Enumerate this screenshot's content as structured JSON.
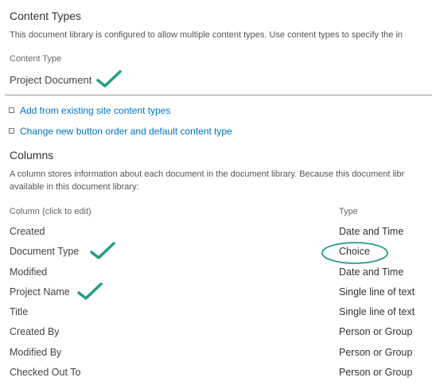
{
  "content_types": {
    "title": "Content Types",
    "description": "This document library is configured to allow multiple content types. Use content types to specify the in",
    "column_header": "Content Type",
    "items": [
      "Project Document"
    ]
  },
  "links": [
    {
      "label": "Add from existing site content types"
    },
    {
      "label": "Change new button order and default content type"
    }
  ],
  "columns": {
    "title": "Columns",
    "description_line1": "A column stores information about each document in the document library. Because this document libr",
    "description_line2": "available in this document library:",
    "header_column": "Column (click to edit)",
    "header_type": "Type",
    "rows": [
      {
        "name": "Created",
        "type": "Date and Time"
      },
      {
        "name": "Document Type",
        "type": "Choice"
      },
      {
        "name": "Modified",
        "type": "Date and Time"
      },
      {
        "name": "Project Name",
        "type": "Single line of text"
      },
      {
        "name": "Title",
        "type": "Single line of text"
      },
      {
        "name": "Created By",
        "type": "Person or Group"
      },
      {
        "name": "Modified By",
        "type": "Person or Group"
      },
      {
        "name": "Checked Out To",
        "type": "Person or Group"
      }
    ]
  },
  "annotations": {
    "checkmark_color": "#1f9e82",
    "highlight_oval_color": "#1f9e82",
    "checked_items": [
      "Project Document",
      "Document Type",
      "Project Name"
    ],
    "circled_item": "Choice"
  },
  "colors": {
    "link": "#0072c6",
    "divider": "#9a9a9a"
  }
}
